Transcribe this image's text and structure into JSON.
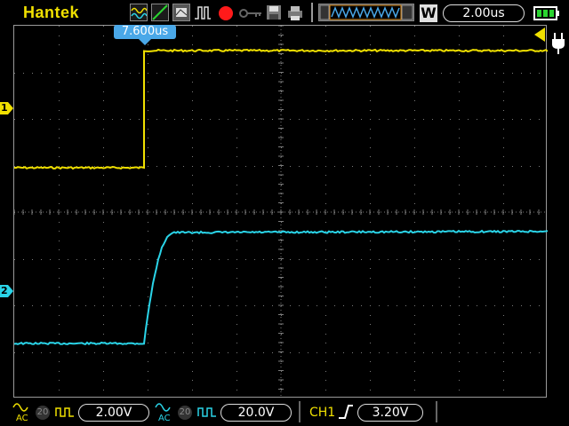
{
  "topbar": {
    "brand": "Hantek",
    "timebase": "2.00us",
    "mode_letter": "W",
    "icons": [
      "wave-icon",
      "ramp-icon",
      "persistence-icon",
      "pulse-icon",
      "record-icon",
      "key-icon",
      "save-icon",
      "print-icon",
      "memory-depth-icon",
      "battery-icon"
    ]
  },
  "screen": {
    "trigger_marker_label": "7.600us",
    "channel_markers": [
      "1",
      "2"
    ]
  },
  "bottombar": {
    "ch1": {
      "coupling": "AC",
      "probe": "20",
      "volts": "2.00V"
    },
    "ch2": {
      "coupling": "AC",
      "probe": "20",
      "volts": "20.0V"
    },
    "trigger": {
      "source": "CH1",
      "level": "3.20V"
    }
  },
  "colors": {
    "ch1": "#f0e000",
    "ch2": "#2ad4e8",
    "brand": "#f0e000",
    "trigger_marker": "#4aa8e8",
    "grid": "#7a7a7a"
  }
}
